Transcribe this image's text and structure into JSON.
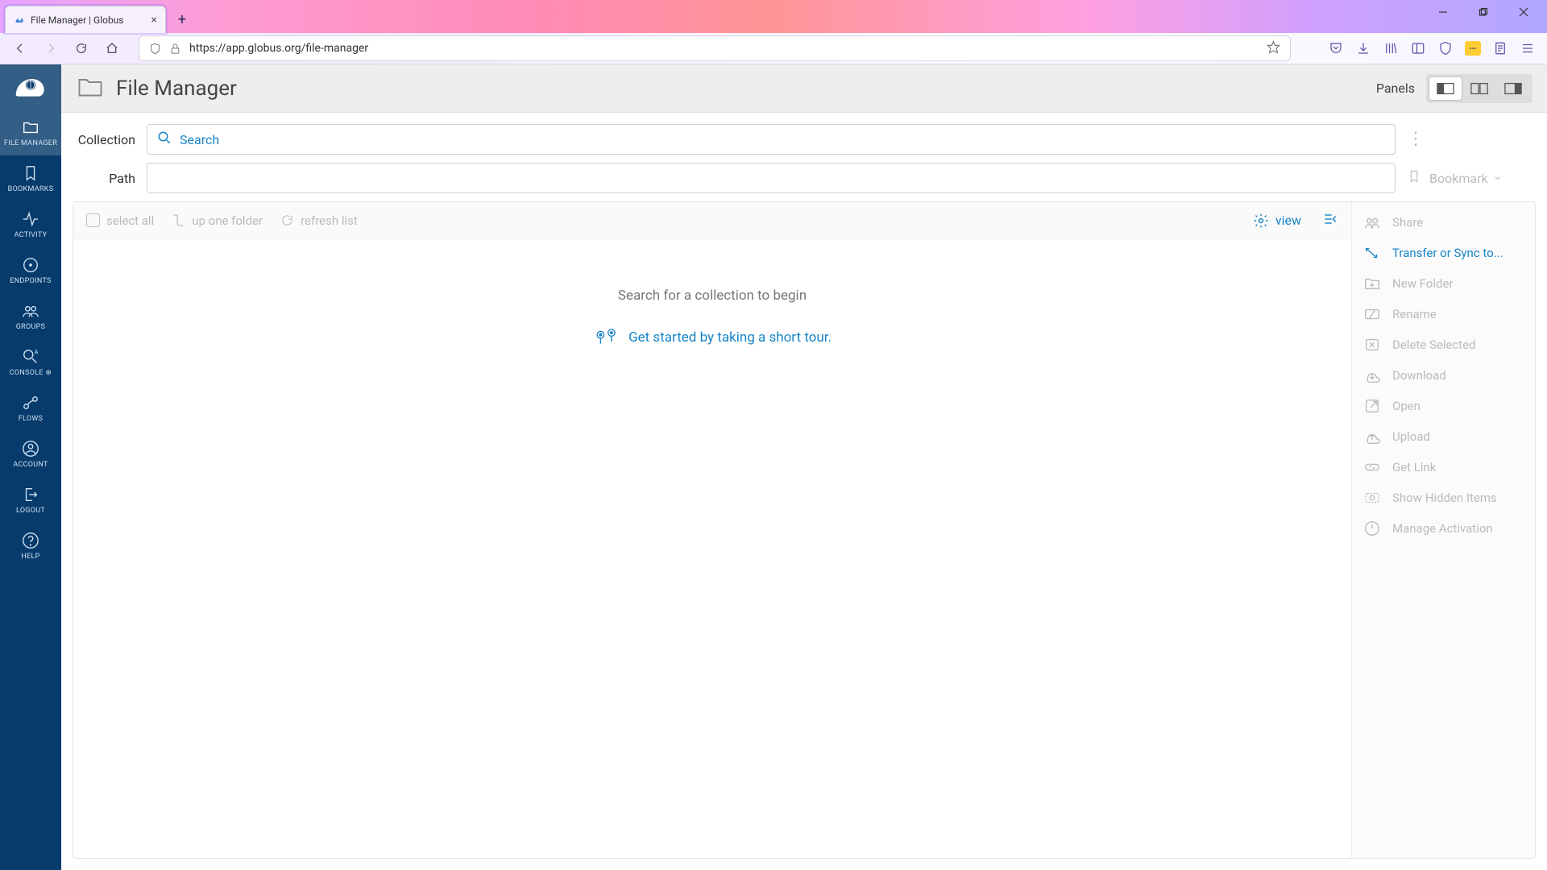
{
  "browser": {
    "tab_title": "File Manager | Globus",
    "url": "https://app.globus.org/file-manager"
  },
  "leftnav": {
    "items": [
      {
        "label": "FILE MANAGER"
      },
      {
        "label": "BOOKMARKS"
      },
      {
        "label": "ACTIVITY"
      },
      {
        "label": "ENDPOINTS"
      },
      {
        "label": "GROUPS"
      },
      {
        "label": "CONSOLE ⊕"
      },
      {
        "label": "FLOWS"
      },
      {
        "label": "ACCOUNT"
      },
      {
        "label": "LOGOUT"
      },
      {
        "label": "HELP"
      }
    ]
  },
  "header": {
    "title": "File Manager",
    "panels_label": "Panels"
  },
  "rows": {
    "collection_label": "Collection",
    "collection_placeholder": "Search",
    "path_label": "Path",
    "bookmark_label": "Bookmark"
  },
  "toolbar": {
    "select_all": "select all",
    "up_one": "up one folder",
    "refresh": "refresh list",
    "view": "view"
  },
  "empty": {
    "message": "Search for a collection to begin",
    "tour": "Get started by taking a short tour."
  },
  "actions": {
    "items": [
      {
        "label": "Share"
      },
      {
        "label": "Transfer or Sync to..."
      },
      {
        "label": "New Folder"
      },
      {
        "label": "Rename"
      },
      {
        "label": "Delete Selected"
      },
      {
        "label": "Download"
      },
      {
        "label": "Open"
      },
      {
        "label": "Upload"
      },
      {
        "label": "Get Link"
      },
      {
        "label": "Show Hidden Items"
      },
      {
        "label": "Manage Activation"
      }
    ]
  }
}
